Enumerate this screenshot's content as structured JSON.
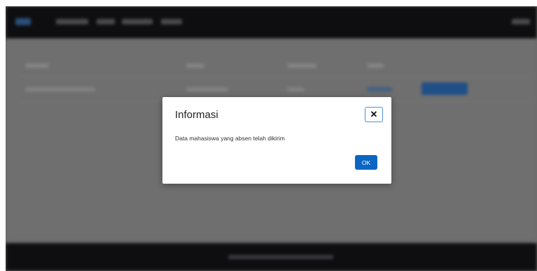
{
  "modal": {
    "title": "Informasi",
    "message": "Data mahasiswa yang absen telah dikirim",
    "close_icon": "close-icon",
    "ok_label": "OK"
  },
  "colors": {
    "accent": "#0a66c2",
    "overlay": "#6b6b6b",
    "navbar": "#0e0e10"
  }
}
